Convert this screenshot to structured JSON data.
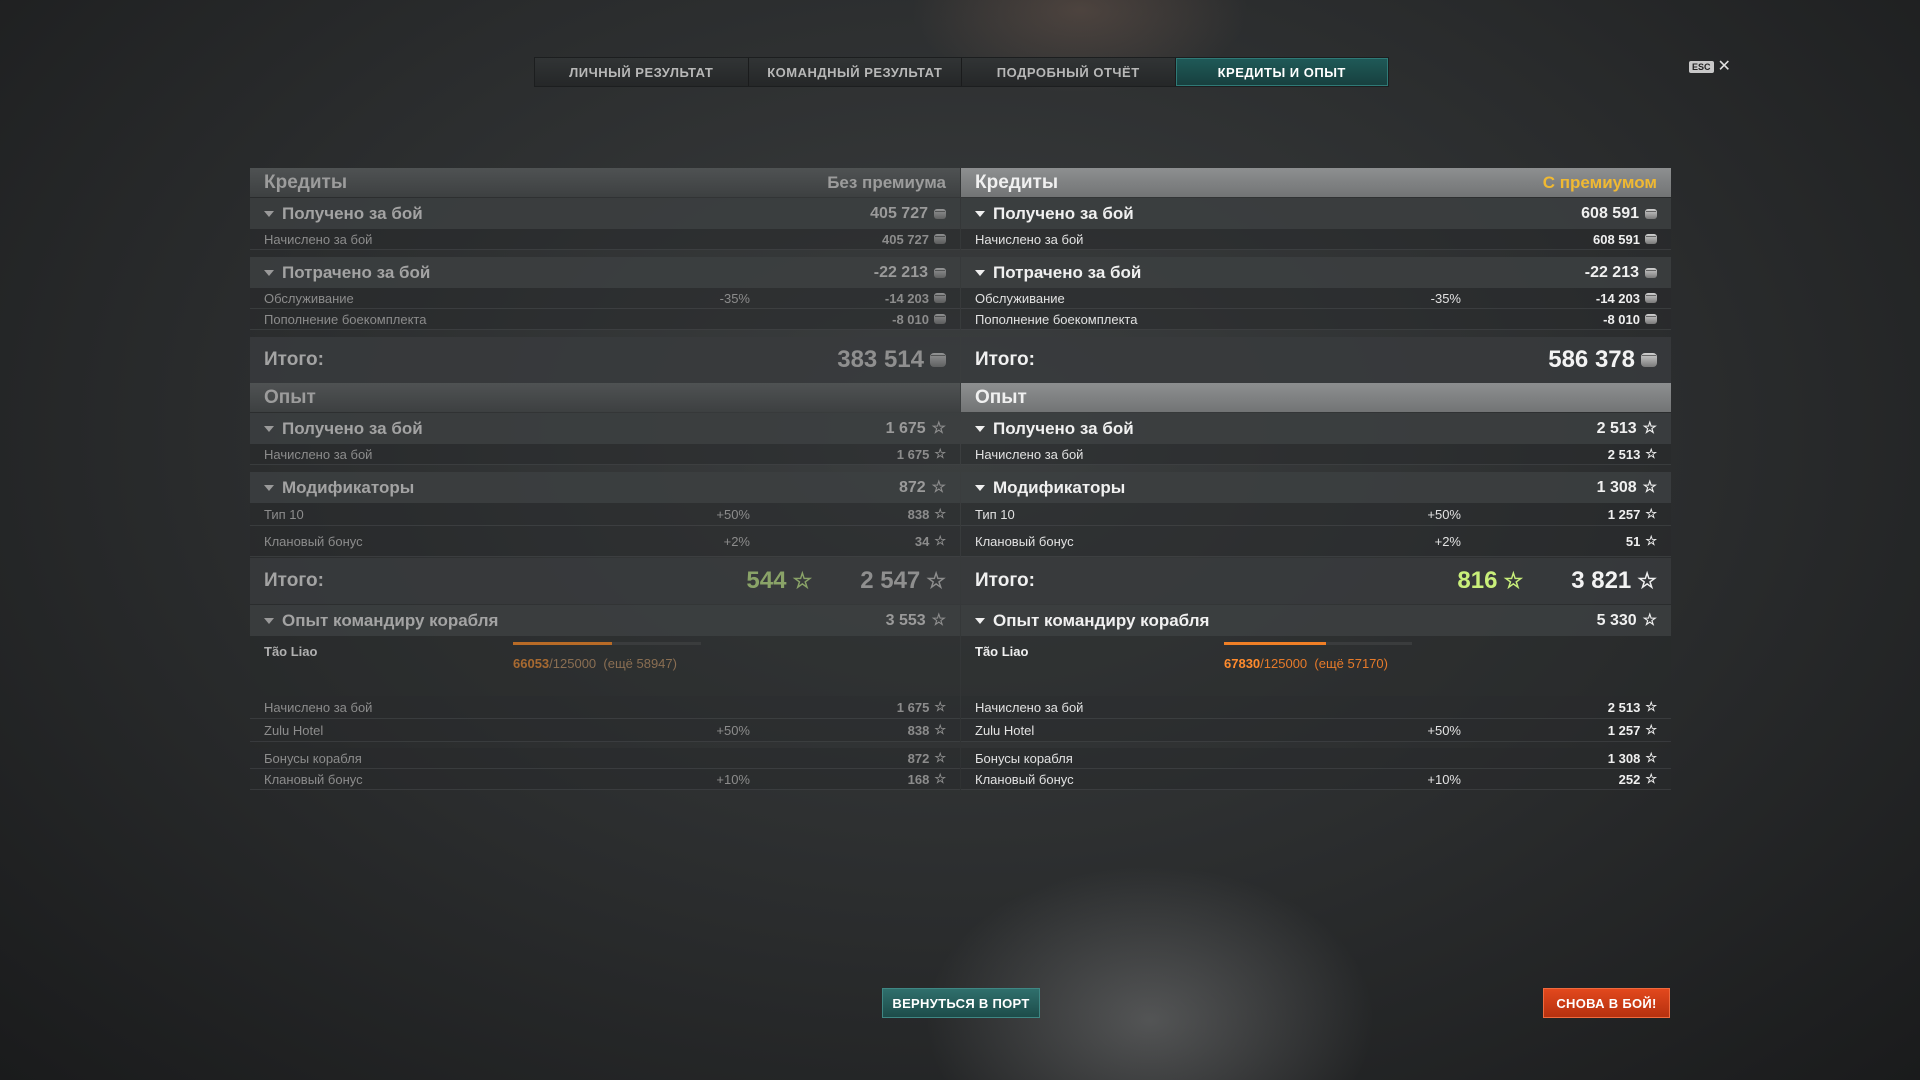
{
  "tabs": [
    {
      "label": "ЛИЧНЫЙ РЕЗУЛЬТАТ"
    },
    {
      "label": "КОМАНДНЫЙ РЕЗУЛЬТАТ"
    },
    {
      "label": "ПОДРОБНЫЙ ОТЧЁТ"
    },
    {
      "label": "КРЕДИТЫ И ОПЫТ"
    }
  ],
  "esc": {
    "key": "ESC",
    "close": "✕"
  },
  "left": {
    "credits": {
      "title": "Кредиты",
      "premium_label": "Без премиума",
      "earned": {
        "label": "Получено за бой",
        "value": "405 727"
      },
      "earned_rows": [
        {
          "label": "Начислено за бой",
          "value": "405 727"
        }
      ],
      "spent": {
        "label": "Потрачено за бой",
        "value": "-22 213"
      },
      "spent_rows": [
        {
          "label": "Обслуживание",
          "pct": "-35%",
          "value": "-14 203"
        },
        {
          "label": "Пополнение боекомплекта",
          "pct": "",
          "value": "-8 010"
        }
      ],
      "total": {
        "label": "Итого:",
        "value": "383 514"
      }
    },
    "xp": {
      "title": "Опыт",
      "earned": {
        "label": "Получено за бой",
        "value": "1 675"
      },
      "earned_rows": [
        {
          "label": "Начислено за бой",
          "value": "1 675"
        }
      ],
      "mods": {
        "label": "Модификаторы",
        "value": "872"
      },
      "mods_rows": [
        {
          "label": "Тип 10",
          "pct": "+50%",
          "value": "838"
        },
        {
          "label": "Клановый бонус",
          "pct": "+2%",
          "value": "34"
        }
      ],
      "total": {
        "label": "Итого:",
        "base": "544",
        "value": "2 547"
      }
    },
    "commander": {
      "label": "Опыт командиру корабля",
      "value": "3 553",
      "name": "Tão Liao",
      "progress_fraction": 0.528,
      "xp_current": "66053",
      "xp_max": "/125000",
      "xp_remaining": "(ещё 58947)",
      "rows1": [
        {
          "label": "Начислено за бой",
          "pct": "",
          "value": "1 675"
        },
        {
          "label": "Zulu Hotel",
          "pct": "+50%",
          "value": "838"
        }
      ],
      "rows2": [
        {
          "label": "Бонусы корабля",
          "pct": "",
          "value": "872"
        },
        {
          "label": "Клановый бонус",
          "pct": "+10%",
          "value": "168"
        }
      ]
    }
  },
  "right": {
    "credits": {
      "title": "Кредиты",
      "premium_label": "С премиумом",
      "earned": {
        "label": "Получено за бой",
        "value": "608 591"
      },
      "earned_rows": [
        {
          "label": "Начислено за бой",
          "value": "608 591"
        }
      ],
      "spent": {
        "label": "Потрачено за бой",
        "value": "-22 213"
      },
      "spent_rows": [
        {
          "label": "Обслуживание",
          "pct": "-35%",
          "value": "-14 203"
        },
        {
          "label": "Пополнение боекомплекта",
          "pct": "",
          "value": "-8 010"
        }
      ],
      "total": {
        "label": "Итого:",
        "value": "586 378"
      }
    },
    "xp": {
      "title": "Опыт",
      "earned": {
        "label": "Получено за бой",
        "value": "2 513"
      },
      "earned_rows": [
        {
          "label": "Начислено за бой",
          "value": "2 513"
        }
      ],
      "mods": {
        "label": "Модификаторы",
        "value": "1 308"
      },
      "mods_rows": [
        {
          "label": "Тип 10",
          "pct": "+50%",
          "value": "1 257"
        },
        {
          "label": "Клановый бонус",
          "pct": "+2%",
          "value": "51"
        }
      ],
      "total": {
        "label": "Итого:",
        "base": "816",
        "value": "3 821"
      }
    },
    "commander": {
      "label": "Опыт командиру корабля",
      "value": "5 330",
      "name": "Tão Liao",
      "progress_fraction": 0.542,
      "xp_current": "67830",
      "xp_max": "/125000",
      "xp_remaining": "(ещё 57170)",
      "rows1": [
        {
          "label": "Начислено за бой",
          "pct": "",
          "value": "2 513"
        },
        {
          "label": "Zulu Hotel",
          "pct": "+50%",
          "value": "1 257"
        }
      ],
      "rows2": [
        {
          "label": "Бонусы корабля",
          "pct": "",
          "value": "1 308"
        },
        {
          "label": "Клановый бонус",
          "pct": "+10%",
          "value": "252"
        }
      ]
    }
  },
  "buttons": {
    "port": "ВЕРНУТЬСЯ В ПОРТ",
    "battle": "СНОВА В БОЙ!"
  },
  "colors": {
    "active_tab": "#1f5a58",
    "premium_accent": "#f0b932",
    "base_xp_green": "#c9ef7a",
    "commander_xp_orange": "#ef7f26",
    "battle_button": "#e2481d",
    "port_button": "#2f6f6c"
  },
  "icons": {
    "credit": "credit-coin-icon",
    "xp": "star-icon",
    "collapse": "triangle-down-icon",
    "close": "close-icon"
  }
}
